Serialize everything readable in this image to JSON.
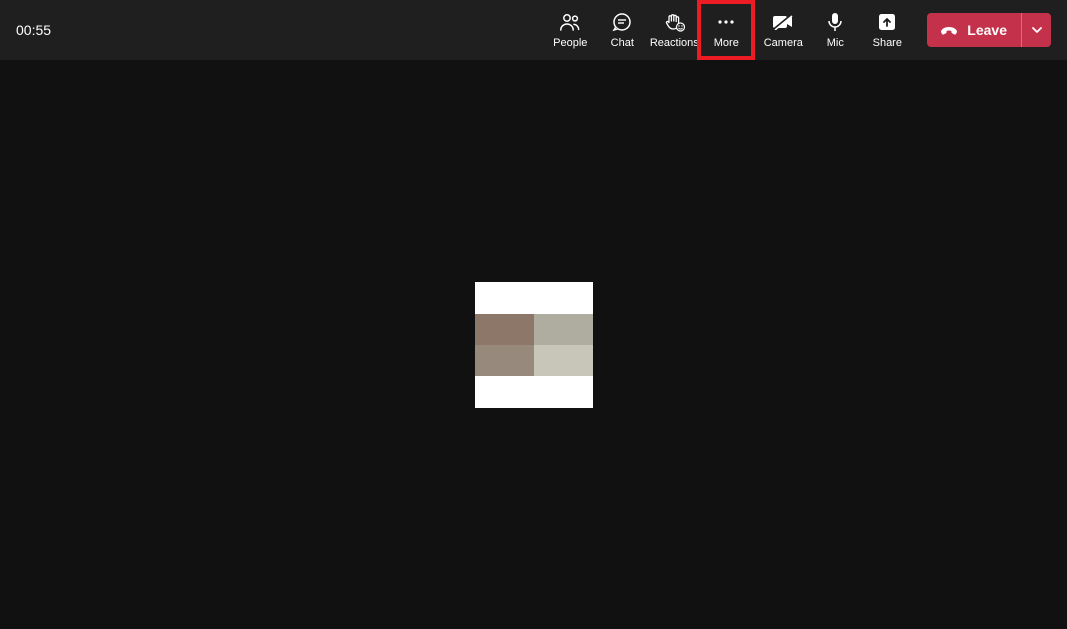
{
  "timer": "00:55",
  "toolbar": {
    "people": "People",
    "chat": "Chat",
    "reactions": "Reactions",
    "more": "More",
    "camera": "Camera",
    "mic": "Mic",
    "share": "Share"
  },
  "leave": {
    "label": "Leave"
  }
}
